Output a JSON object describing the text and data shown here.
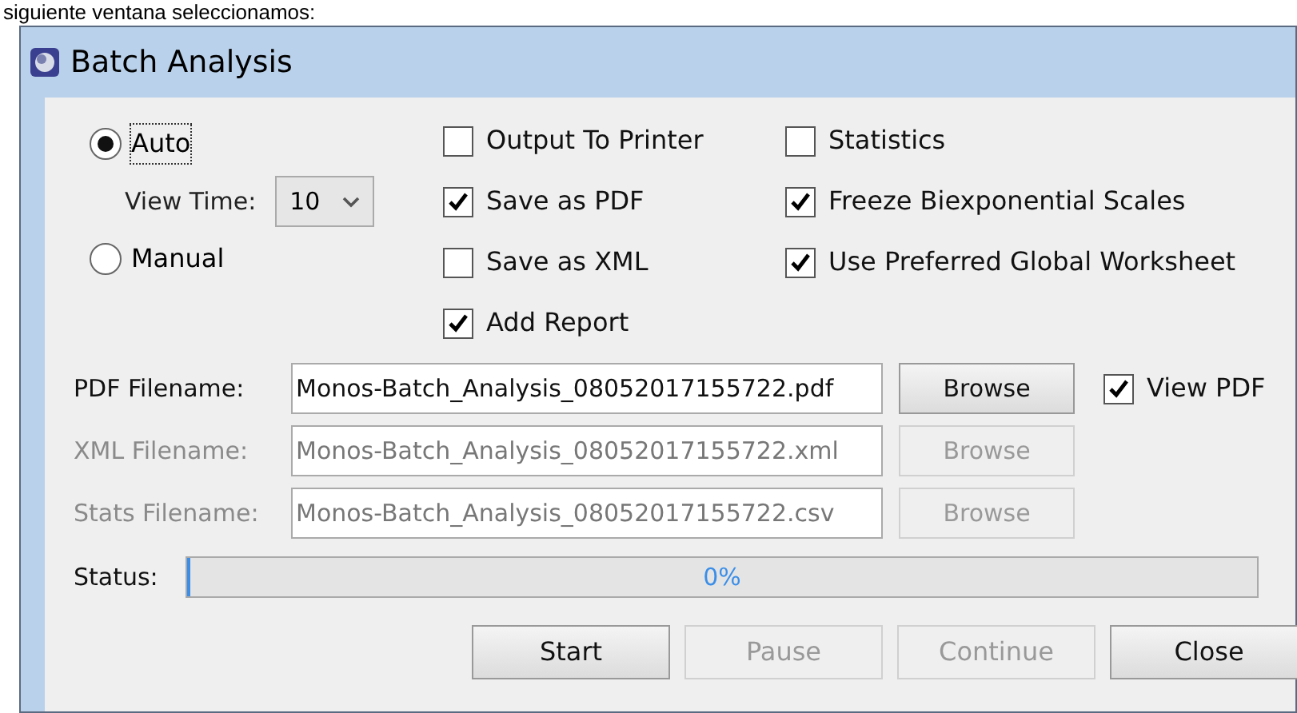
{
  "page_text": "siguiente ventana seleccionamos:",
  "window": {
    "title": "Batch Analysis"
  },
  "modes": [
    {
      "label": "Auto",
      "selected": true
    },
    {
      "label": "Manual",
      "selected": false
    }
  ],
  "view_time": {
    "label": "View Time:",
    "value": "10"
  },
  "options_column_1": [
    {
      "label": "Output To Printer",
      "checked": false
    },
    {
      "label": "Save as PDF",
      "checked": true
    },
    {
      "label": "Save as XML",
      "checked": false
    },
    {
      "label": "Add Report",
      "checked": true
    }
  ],
  "options_column_2": [
    {
      "label": "Statistics",
      "checked": false
    },
    {
      "label": "Freeze Biexponential Scales",
      "checked": true
    },
    {
      "label": "Use Preferred Global Worksheet",
      "checked": true
    }
  ],
  "files": [
    {
      "label": "PDF Filename:",
      "value": "Monos-Batch_Analysis_08052017155722.pdf",
      "disabled": false,
      "button": "Browse"
    },
    {
      "label": "XML Filename:",
      "value": "Monos-Batch_Analysis_08052017155722.xml",
      "disabled": true,
      "button": "Browse"
    },
    {
      "label": "Stats Filename:",
      "value": "Monos-Batch_Analysis_08052017155722.csv",
      "disabled": true,
      "button": "Browse"
    }
  ],
  "view_pdf": {
    "label": "View PDF",
    "checked": true
  },
  "status": {
    "label": "Status:",
    "level": 0,
    "reading": "0%"
  },
  "buttons": [
    {
      "label": "Start",
      "disabled": false
    },
    {
      "label": "Pause",
      "disabled": true
    },
    {
      "label": "Continue",
      "disabled": true
    },
    {
      "label": "Close",
      "disabled": false
    }
  ]
}
